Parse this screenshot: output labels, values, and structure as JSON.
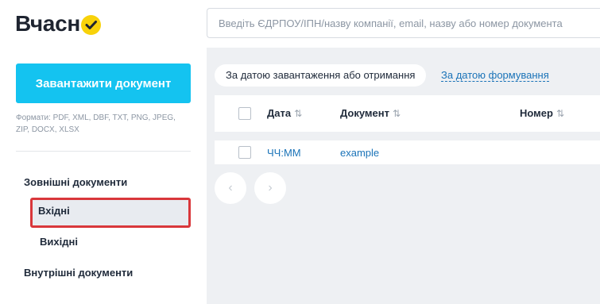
{
  "header": {
    "logo_text": "Вчасн",
    "search_placeholder": "Введіть ЄДРПОУ/ІПН/назву компанії, email, назву або номер документа"
  },
  "sidebar": {
    "upload_button": "Завантажити документ",
    "formats": "Формати: PDF, XML, DBF, TXT, PNG, JPEG, ZIP, DOCX, XLSX",
    "external_title": "Зовнішні документи",
    "incoming": "Вхідні",
    "outgoing": "Вихідні",
    "internal_title": "Внутрішні документи"
  },
  "sort": {
    "by_upload": "За датою завантаження або отримання",
    "by_creation": "За датою формування"
  },
  "table": {
    "columns": [
      "Дата",
      "Документ",
      "Номер"
    ],
    "sort_icon": "⇅",
    "rows": [
      {
        "date": "ЧЧ:ММ",
        "document": "example",
        "number": ""
      }
    ]
  },
  "pagination": {
    "prev": "‹",
    "next": "›"
  },
  "colors": {
    "accent": "#14c3f0",
    "logo_yellow": "#f8d20a",
    "link": "#1a73b8",
    "highlight_border": "#d9373b"
  }
}
